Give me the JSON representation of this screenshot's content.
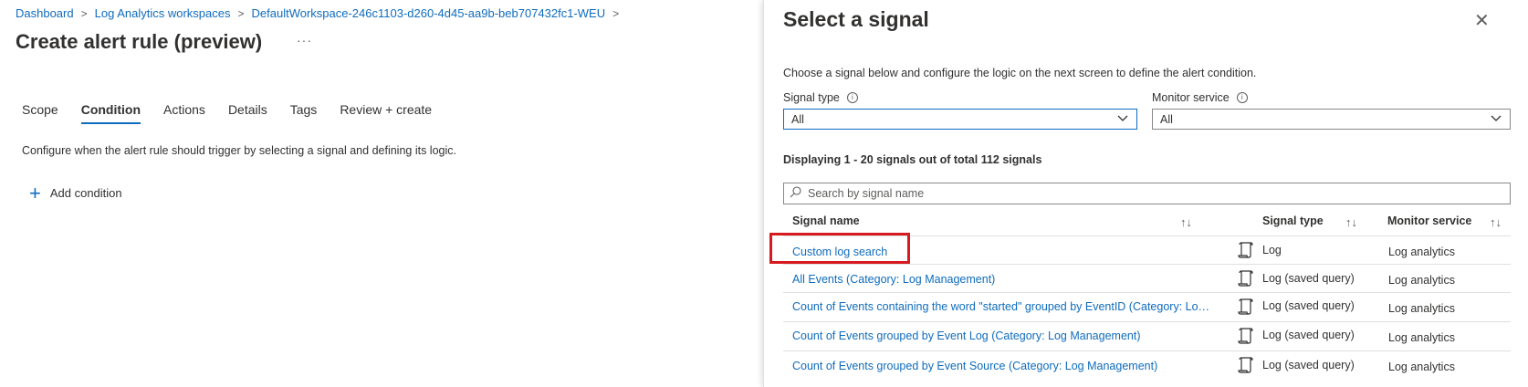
{
  "breadcrumb": [
    "Dashboard",
    "Log Analytics workspaces",
    "DefaultWorkspace-246c1103-d260-4d45-aa9b-beb707432fc1-WEU"
  ],
  "page": {
    "title": "Create alert rule (preview)",
    "more": "···",
    "tabs": [
      "Scope",
      "Condition",
      "Actions",
      "Details",
      "Tags",
      "Review + create"
    ],
    "active_tab": "Condition",
    "description": "Configure when the alert rule should trigger by selecting a signal and defining its logic.",
    "add_condition_label": "Add condition",
    "add_condition_icon": "plus-icon"
  },
  "panel": {
    "title": "Select a signal",
    "close_icon": "close-icon",
    "description": "Choose a signal below and configure the logic on the next screen to define the alert condition.",
    "signal_type_label": "Signal type",
    "signal_type_value": "All",
    "monitor_service_label": "Monitor service",
    "monitor_service_value": "All",
    "count_text": "Displaying 1 - 20 signals out of total 112 signals",
    "search_placeholder": "Search by signal name",
    "columns": [
      "Signal name",
      "Signal type",
      "Monitor service"
    ],
    "rows": [
      {
        "name": "Custom log search",
        "type": "Log",
        "service": "Log analytics"
      },
      {
        "name": "All Events (Category: Log Management)",
        "type": "Log (saved query)",
        "service": "Log analytics"
      },
      {
        "name": "Count of Events containing the word \"started\" grouped by EventID (Category: Log Management)",
        "type": "Log (saved query)",
        "service": "Log analytics"
      },
      {
        "name": "Count of Events grouped by Event Log (Category: Log Management)",
        "type": "Log (saved query)",
        "service": "Log analytics"
      },
      {
        "name": "Count of Events grouped by Event Source (Category: Log Management)",
        "type": "Log (saved query)",
        "service": "Log analytics"
      }
    ]
  },
  "colors": {
    "accent": "#0f6cbd",
    "highlight": "#d71920"
  }
}
